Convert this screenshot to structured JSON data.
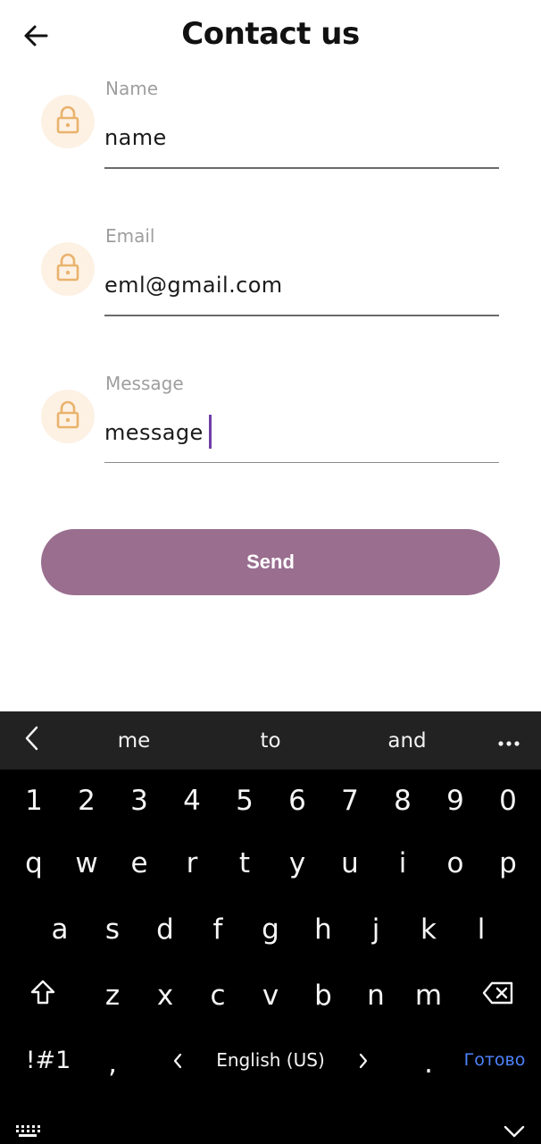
{
  "header": {
    "title": "Contact us",
    "back_icon": "arrow-left-icon"
  },
  "form": {
    "fields": [
      {
        "label": "Name",
        "value": "name",
        "icon": "lock-icon"
      },
      {
        "label": "Email",
        "value": "eml@gmail.com",
        "icon": "lock-icon"
      },
      {
        "label": "Message",
        "value": "message",
        "icon": "lock-icon"
      }
    ],
    "send_label": "Send"
  },
  "colors": {
    "accent": "#9a6e8f",
    "icon_bg": "#fdf1e4",
    "icon_color": "#e9b36c",
    "caret": "#6f3fa8"
  },
  "keyboard": {
    "suggestions": [
      "me",
      "to",
      "and"
    ],
    "number_row": [
      "1",
      "2",
      "3",
      "4",
      "5",
      "6",
      "7",
      "8",
      "9",
      "0"
    ],
    "row1": [
      "q",
      "w",
      "e",
      "r",
      "t",
      "y",
      "u",
      "i",
      "o",
      "p"
    ],
    "row2": [
      "a",
      "s",
      "d",
      "f",
      "g",
      "h",
      "j",
      "k",
      "l"
    ],
    "row3": [
      "z",
      "x",
      "c",
      "v",
      "b",
      "n",
      "m"
    ],
    "symbols_key": "!#1",
    "comma_key": ",",
    "language": "English (US)",
    "period_key": ".",
    "done_key": "Готово"
  }
}
